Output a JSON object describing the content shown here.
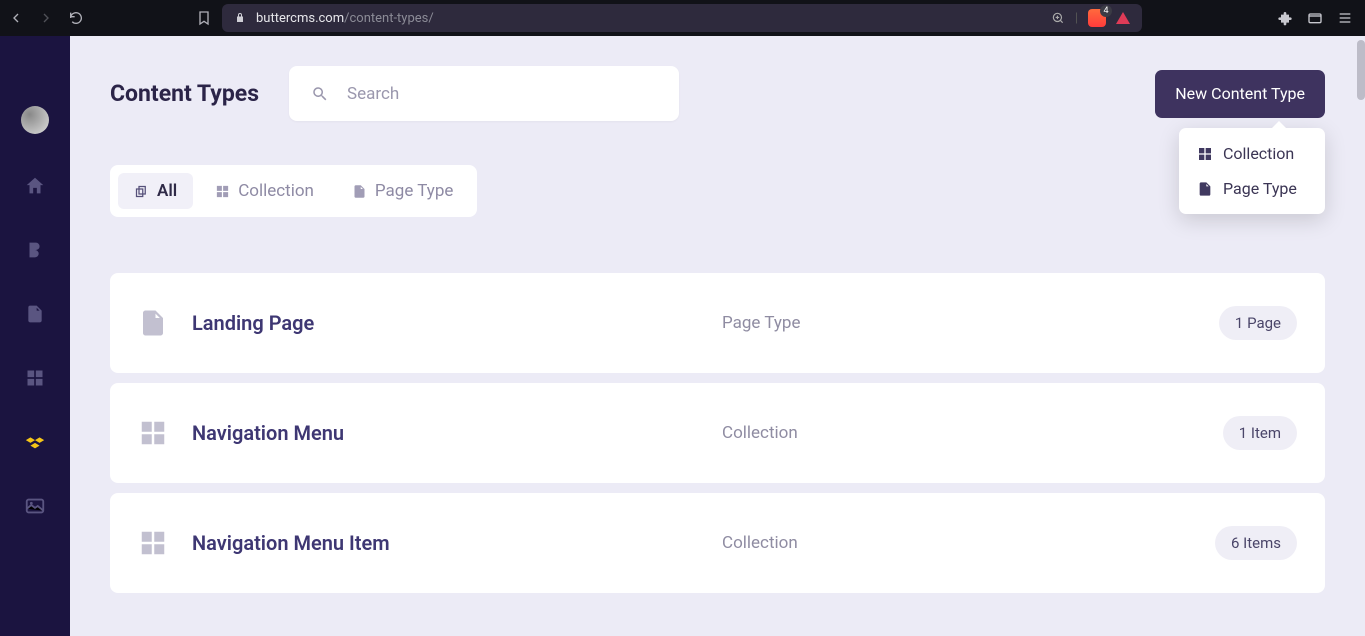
{
  "browser": {
    "url_domain": "buttercms.com",
    "url_path": "/content-types/",
    "shield_count": "4"
  },
  "page": {
    "title": "Content Types"
  },
  "search": {
    "placeholder": "Search"
  },
  "new_button": {
    "label": "New Content Type"
  },
  "dropdown": {
    "items": [
      {
        "label": "Collection",
        "icon": "grid"
      },
      {
        "label": "Page Type",
        "icon": "page"
      }
    ]
  },
  "filters": {
    "tabs": [
      {
        "label": "All",
        "icon": "copy",
        "active": true
      },
      {
        "label": "Collection",
        "icon": "grid",
        "active": false
      },
      {
        "label": "Page Type",
        "icon": "page",
        "active": false
      }
    ]
  },
  "content_types": [
    {
      "title": "Landing Page",
      "kind": "Page Type",
      "badge": "1 Page",
      "icon": "page"
    },
    {
      "title": "Navigation Menu",
      "kind": "Collection",
      "badge": "1 Item",
      "icon": "grid"
    },
    {
      "title": "Navigation Menu Item",
      "kind": "Collection",
      "badge": "6 Items",
      "icon": "grid"
    }
  ]
}
